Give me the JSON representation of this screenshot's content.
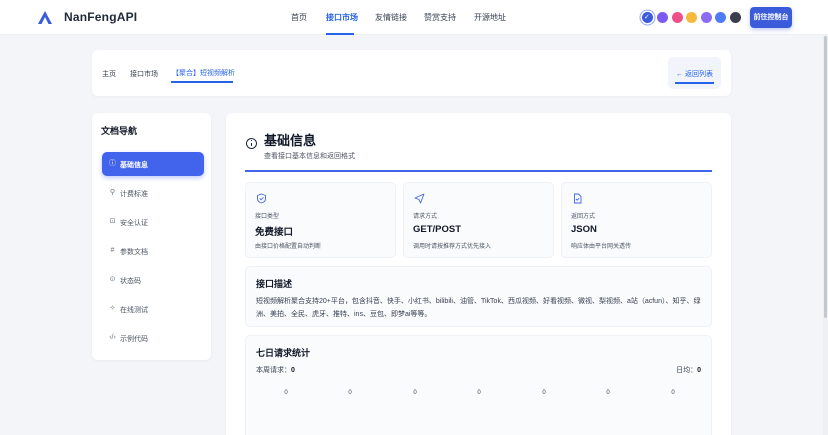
{
  "header": {
    "brand": "NanFengAPI",
    "nav": [
      "首页",
      "接口市场",
      "友情链接",
      "赞赏支持",
      "开源地址"
    ],
    "active_nav": "接口市场",
    "theme_colors": [
      "#3b5bdb",
      "#7c5cf0",
      "#ef4f8b",
      "#f59e0b",
      "#7c5cf0",
      "#3b82f6",
      "#374151"
    ],
    "selected_theme": "#3b5bdb",
    "console_button": "前往控制台"
  },
  "breadcrumb": {
    "items": [
      "主页",
      "接口市场",
      "【聚合】短视频解析"
    ],
    "back": "返回列表"
  },
  "sidebar": {
    "title": "文档导航",
    "items": [
      {
        "label": "基础信息",
        "icon": "info-icon"
      },
      {
        "label": "计费标准",
        "icon": "link-icon"
      },
      {
        "label": "安全认证",
        "icon": "lock-icon"
      },
      {
        "label": "参数文档",
        "icon": "hash-icon"
      },
      {
        "label": "状态码",
        "icon": "status-icon"
      },
      {
        "label": "在线测试",
        "icon": "sparkle-icon"
      },
      {
        "label": "示例代码",
        "icon": "code-icon"
      }
    ],
    "active": "基础信息"
  },
  "main": {
    "title": "基础信息",
    "subtitle": "查看接口基本信息和返回格式",
    "cards": [
      {
        "label": "接口类型",
        "value": "免费接口",
        "desc": "由接口价格配置自动判断",
        "icon": "shield-check-icon"
      },
      {
        "label": "请求方式",
        "value": "GET/POST",
        "desc": "调用时请按推荐方式优先接入",
        "icon": "send-icon"
      },
      {
        "label": "返回方式",
        "value": "JSON",
        "desc": "响应体由平台网关透传",
        "icon": "file-icon"
      }
    ],
    "description": {
      "title": "接口描述",
      "text": "短视频解析聚合支持20+平台，包含抖音、快手、小红书、bilibili、油管、TikTok、西瓜视频、好看视频、微视、梨视频、a站（acfun）、知乎、绿洲、美拍、全民、虎牙、推特、ins、豆包、即梦ai等等。"
    },
    "stats": {
      "title": "七日请求统计",
      "week_label": "本周请求：",
      "week_value": "0",
      "avg_label": "日均：",
      "avg_value": "0",
      "bar_values": [
        "0",
        "0",
        "0",
        "0",
        "0",
        "0",
        "0"
      ]
    }
  }
}
